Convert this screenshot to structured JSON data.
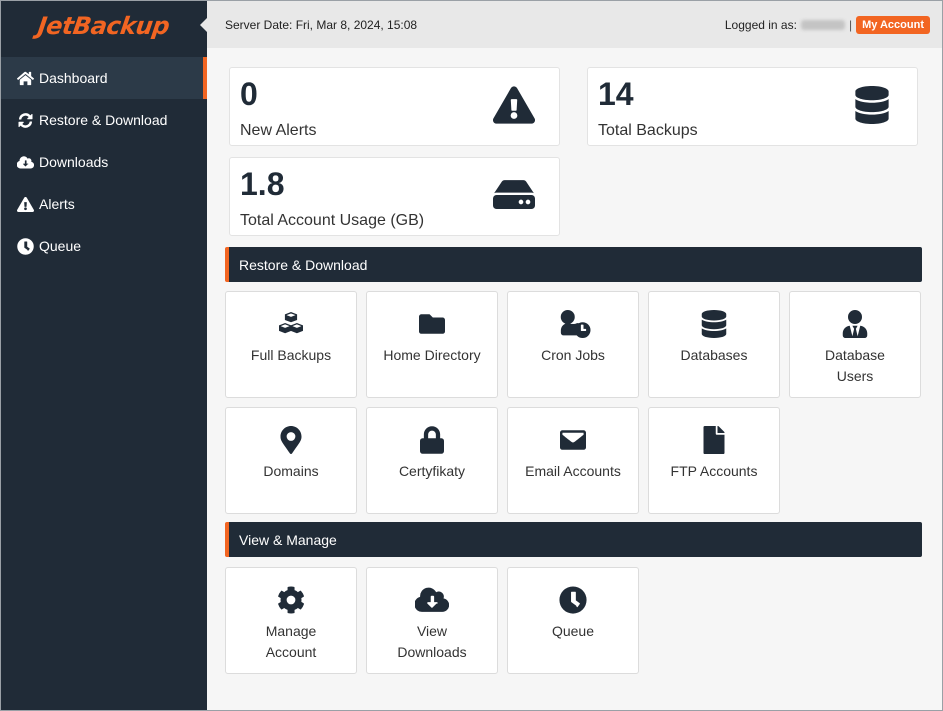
{
  "brand": {
    "name": "JetBackup",
    "accent": "#f26522",
    "dark": "#202b37"
  },
  "sidebar": {
    "items": [
      {
        "label": "Dashboard",
        "icon": "home-icon",
        "active": true
      },
      {
        "label": "Restore & Download",
        "icon": "refresh-icon",
        "active": false
      },
      {
        "label": "Downloads",
        "icon": "cloud-download-icon",
        "active": false
      },
      {
        "label": "Alerts",
        "icon": "warning-icon",
        "active": false
      },
      {
        "label": "Queue",
        "icon": "clock-icon",
        "active": false
      }
    ]
  },
  "topbar": {
    "server_date": "Server Date: Fri, Mar 8, 2024, 15:08",
    "logged_in_label": "Logged in as:",
    "separator": "|",
    "my_account": "My Account"
  },
  "stats": [
    {
      "value": "0",
      "label": "New Alerts",
      "icon": "warning-icon"
    },
    {
      "value": "14",
      "label": "Total Backups",
      "icon": "database-icon"
    },
    {
      "value": "1.8",
      "label": "Total Account Usage (GB)",
      "icon": "hdd-icon"
    }
  ],
  "sections": [
    {
      "title": "Restore & Download",
      "tiles": [
        {
          "label": "Full Backups",
          "icon": "cubes-icon"
        },
        {
          "label": "Home Directory",
          "icon": "folder-icon"
        },
        {
          "label": "Cron Jobs",
          "icon": "user-clock-icon"
        },
        {
          "label": "Databases",
          "icon": "database-icon"
        },
        {
          "label": "Database Users",
          "icon": "user-tie-icon"
        },
        {
          "label": "Domains",
          "icon": "map-marker-icon"
        },
        {
          "label": "Certyfikaty",
          "icon": "lock-icon"
        },
        {
          "label": "Email Accounts",
          "icon": "envelope-icon"
        },
        {
          "label": "FTP Accounts",
          "icon": "file-icon"
        }
      ]
    },
    {
      "title": "View & Manage",
      "tiles": [
        {
          "label": "Manage Account",
          "icon": "gear-icon"
        },
        {
          "label": "View Downloads",
          "icon": "cloud-download-icon"
        },
        {
          "label": "Queue",
          "icon": "clock-icon"
        }
      ]
    }
  ]
}
